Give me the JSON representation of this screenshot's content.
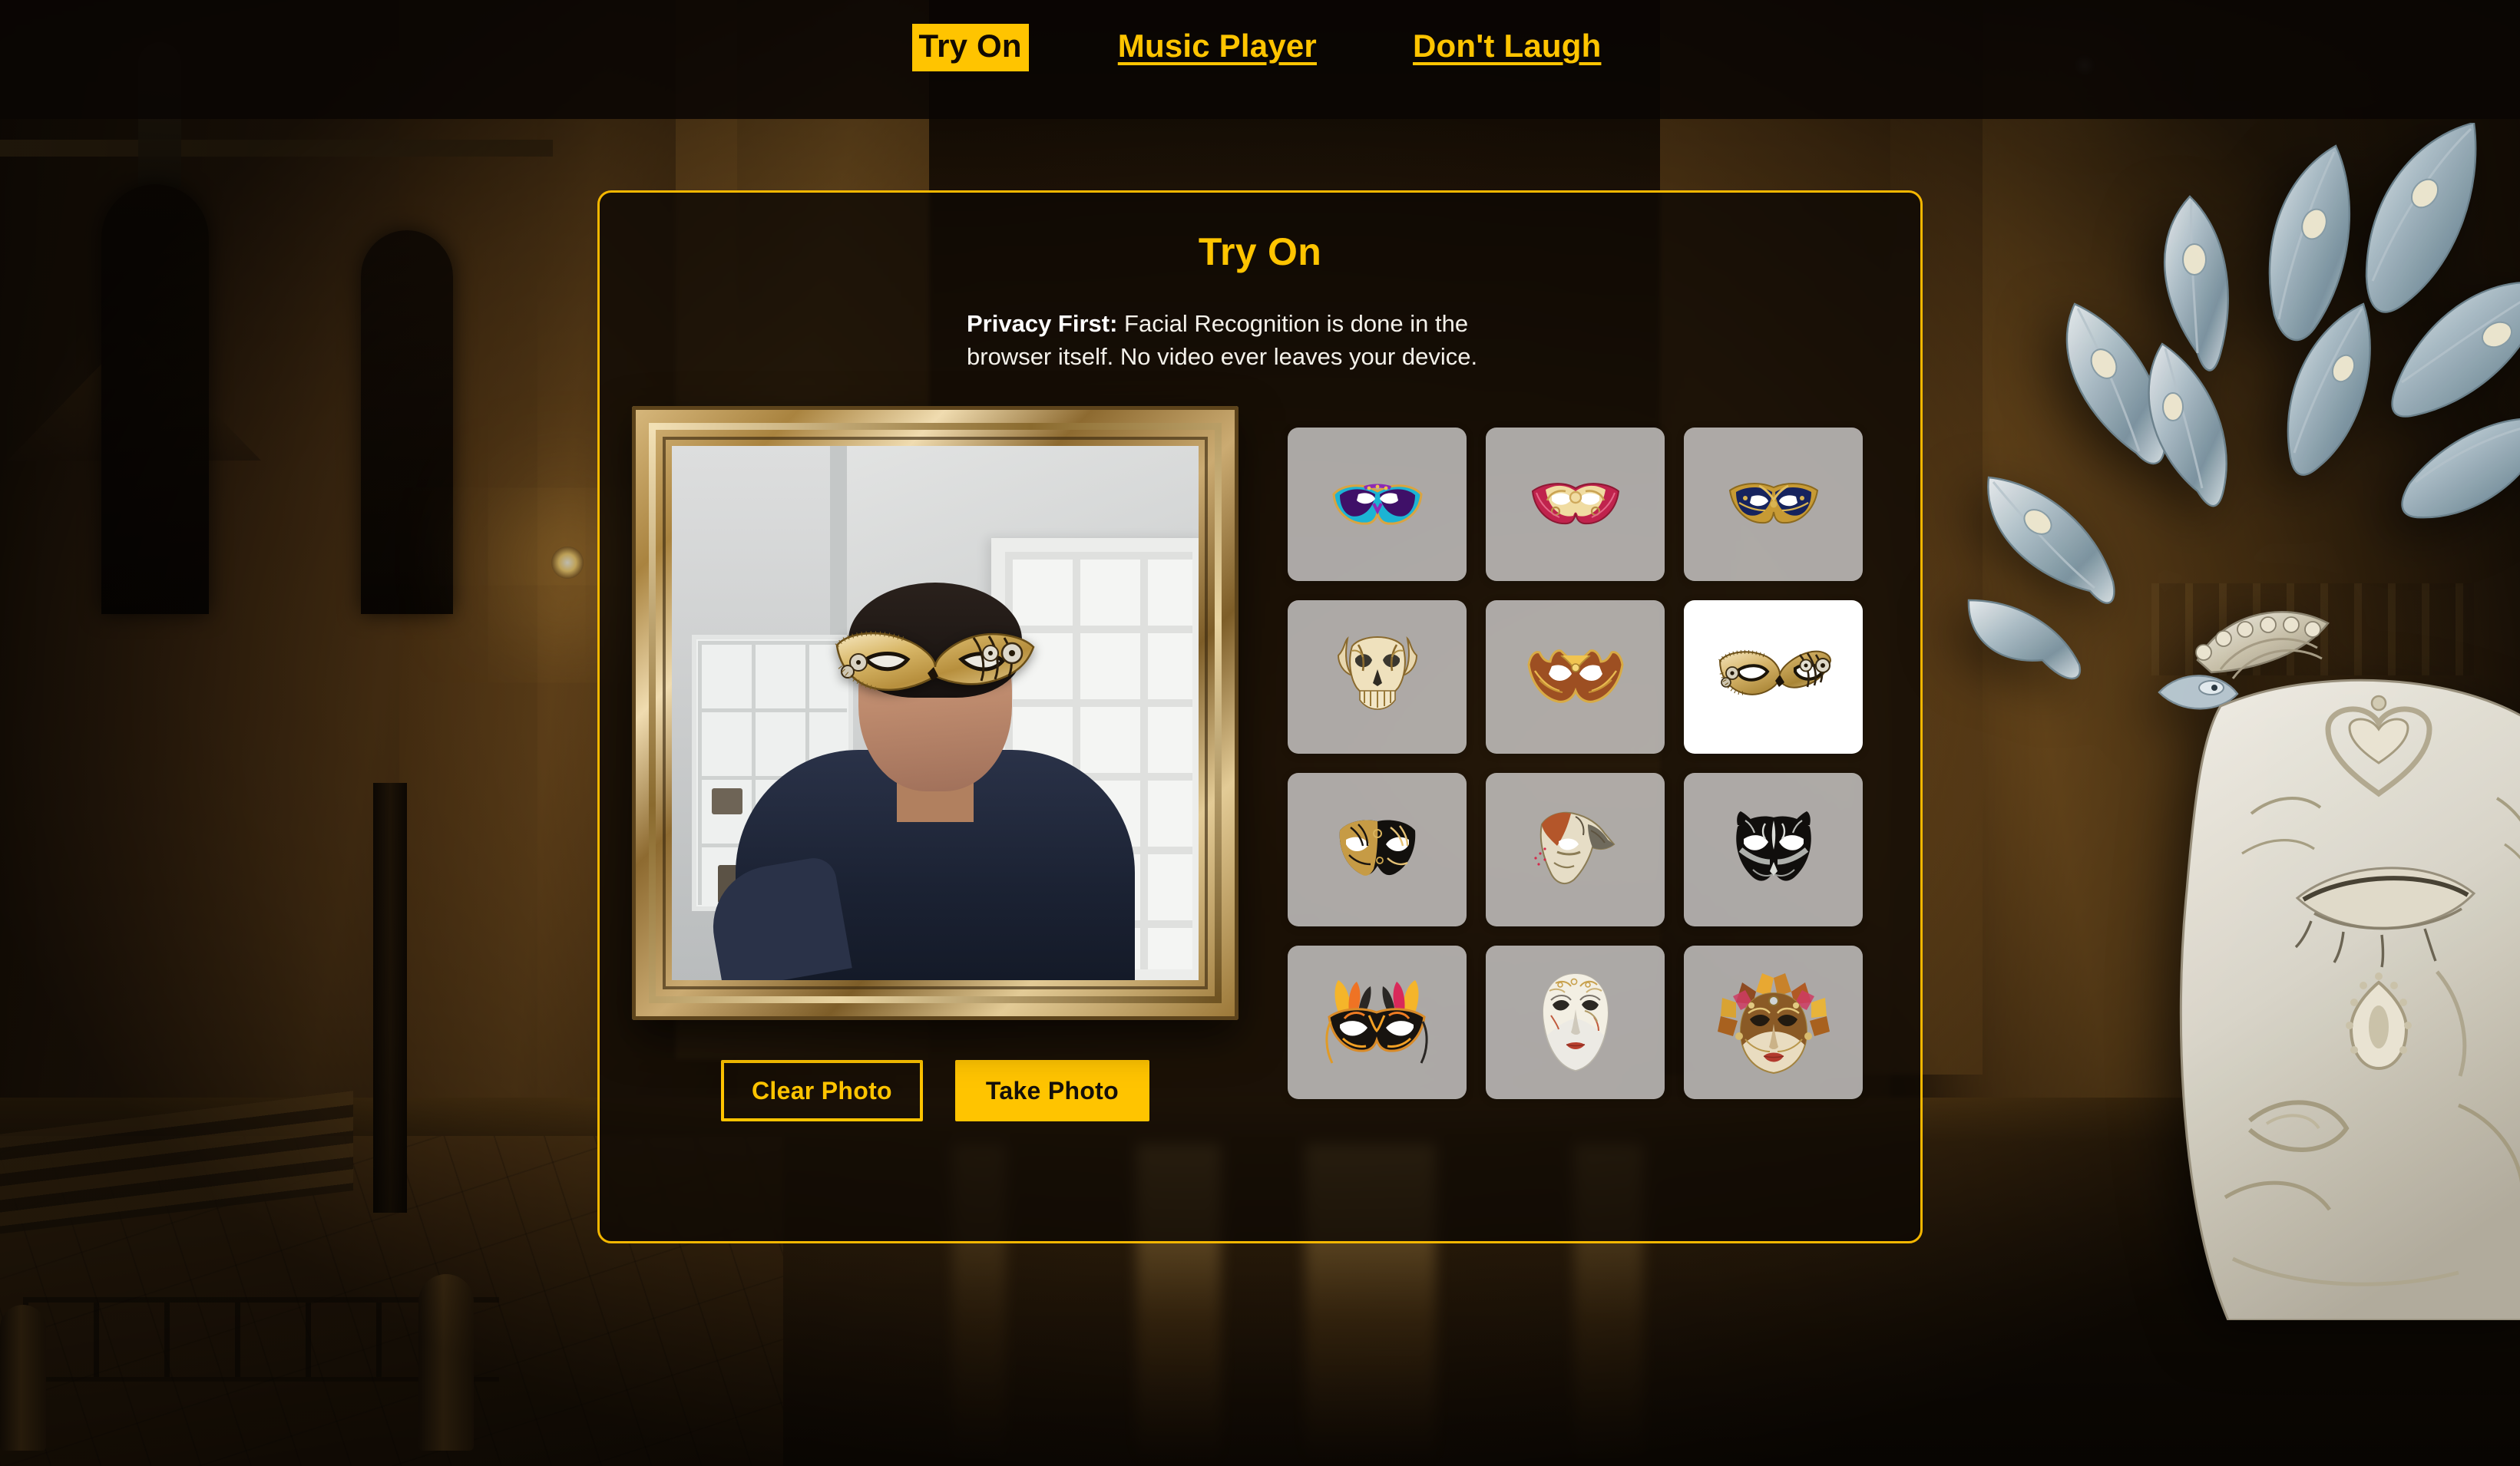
{
  "nav": {
    "items": [
      {
        "label": "Try On",
        "active": true
      },
      {
        "label": "Music Player",
        "active": false
      },
      {
        "label": "Don't Laugh",
        "active": false
      }
    ]
  },
  "card": {
    "title": "Try On",
    "privacy_label": "Privacy First:",
    "privacy_text": " Facial Recognition is done in the browser itself. No video ever leaves your device."
  },
  "camera": {
    "clear_button": "Clear Photo",
    "take_button": "Take Photo",
    "feed_description": "live webcam preview in gold picture frame with AR mask overlay"
  },
  "masks": [
    {
      "id": 1,
      "name": "purple-teal-eye-mask",
      "selected": false
    },
    {
      "id": 2,
      "name": "red-gold-swirl-mask",
      "selected": false
    },
    {
      "id": 3,
      "name": "navy-gold-filigree-mask",
      "selected": false
    },
    {
      "id": 4,
      "name": "cream-gold-skull-mask",
      "selected": false
    },
    {
      "id": 5,
      "name": "gold-bronze-bat-wing-mask",
      "selected": false
    },
    {
      "id": 6,
      "name": "gold-steampunk-side-mask",
      "selected": true
    },
    {
      "id": 7,
      "name": "black-gold-colombina-mask",
      "selected": false
    },
    {
      "id": 8,
      "name": "plague-doctor-beak-mask",
      "selected": false
    },
    {
      "id": 9,
      "name": "black-silver-cat-mask",
      "selected": false
    },
    {
      "id": 10,
      "name": "orange-feathered-mask",
      "selected": false
    },
    {
      "id": 11,
      "name": "white-volto-full-face-mask",
      "selected": false
    },
    {
      "id": 12,
      "name": "gold-jester-fan-mask",
      "selected": false
    }
  ],
  "colors": {
    "accent_yellow": "#FFC400",
    "card_border": "#F5B700",
    "card_background": "rgba(14,9,4,0.80)",
    "header_background": "rgba(10,6,3,0.88)",
    "tile_background": "rgba(228,228,228,0.72)",
    "tile_selected_background": "#FFFFFF",
    "text_light": "#F4F1EA"
  }
}
